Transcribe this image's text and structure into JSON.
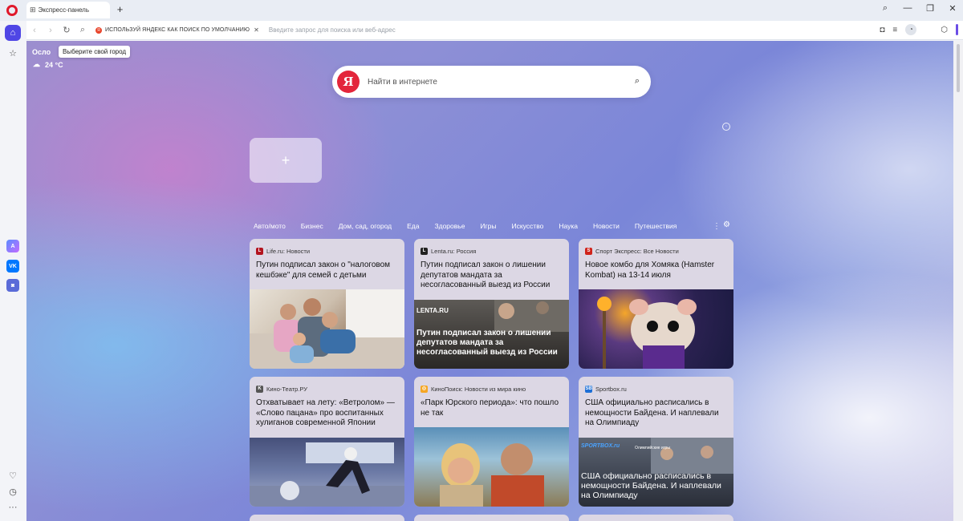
{
  "tab": {
    "title": "Экспресс-панель"
  },
  "addressbar": {
    "promo_text": "ИСПОЛЬЗУЙ ЯНДЕКС КАК ПОИСК ПО УМОЛЧАНИЮ",
    "placeholder": "Введите запрос для поиска или веб-адрес"
  },
  "weather": {
    "city": "Осло",
    "tooltip": "Выберите свой город",
    "temp": "24 °C"
  },
  "search": {
    "logo": "Я",
    "placeholder": "Найти в интернете"
  },
  "categories": [
    "Авто/мото",
    "Бизнес",
    "Дом, сад, огород",
    "Еда",
    "Здоровье",
    "Игры",
    "Искусство",
    "Наука",
    "Новости",
    "Путешествия"
  ],
  "news": [
    {
      "source": "Life.ru: Новости",
      "title": "Путин подписал закон о \"налоговом кешбэке\" для семей с детьми"
    },
    {
      "source": "Lenta.ru: Россия",
      "title": "Путин подписал закон о лишении депутатов мандата за несогласованный выезд из России",
      "img_brand": "LENTA.RU",
      "img_text": "Путин подписал закон о лишении депутатов мандата за несогласованный выезд из России"
    },
    {
      "source": "Спорт Экспресс: Все Новости",
      "title": "Новое комбо для Хомяка (Hamster Kombat) на 13-14 июля"
    },
    {
      "source": "Кино-Театр.РУ",
      "title": "Отхватывает на лету: «Ветролом» — «Слово пацана» про воспитанных хулиганов современной Японии"
    },
    {
      "source": "КиноПоиск: Новости из мира кино",
      "title": "«Парк Юрского периода»: что пошло не так"
    },
    {
      "source": "Sportbox.ru",
      "title": "США официально расписались в немощности Байдена. И наплевали на Олимпиаду",
      "img_brand": "SPORTBOX.ru",
      "img_tag": "Олимпийские игры",
      "img_text": "США официально расписались в немощности Байдена. И наплевали на Олимпиаду"
    }
  ],
  "colors": {
    "accent": "#4f46e5",
    "yandex": "#e3263b",
    "opera": "#e0192b"
  }
}
